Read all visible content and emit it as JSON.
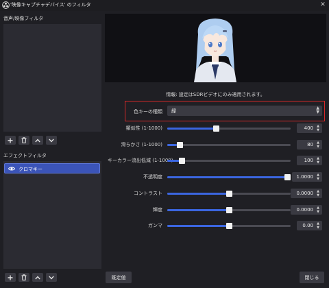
{
  "window": {
    "title": "'映像キャプチャデバイス' のフィルタ",
    "close_glyph": "✕"
  },
  "audio_filters": {
    "label": "音声/映像フィルタ"
  },
  "effect_filters": {
    "label": "エフェクトフィルタ",
    "items": [
      {
        "name": "クロマキー",
        "visible": true
      }
    ]
  },
  "info_text": "情報: 設定はSDRビデオにのみ適用されます。",
  "key_type": {
    "label": "色キーの種類",
    "value": "緑"
  },
  "sliders": [
    {
      "label": "類似性 (1-1000)",
      "value_text": "400",
      "fraction": 0.39
    },
    {
      "label": "滑らかさ (1-1000)",
      "value_text": "80",
      "fraction": 0.08
    },
    {
      "label": "キーカラー流出低減 (1-1000)",
      "value_text": "100",
      "fraction": 0.1
    },
    {
      "label": "不透明度",
      "value_text": "1.0000",
      "fraction": 1.0
    },
    {
      "label": "コントラスト",
      "value_text": "0.0000",
      "fraction": 0.5
    },
    {
      "label": "輝度",
      "value_text": "0.0000",
      "fraction": 0.5
    },
    {
      "label": "ガンマ",
      "value_text": "0.00",
      "fraction": 0.5
    }
  ],
  "buttons": {
    "defaults": "既定値",
    "close": "閉じる"
  },
  "colors": {
    "accent": "#3b66e0",
    "highlight_box": "#d62828",
    "selected_item": "#3b54b8"
  }
}
